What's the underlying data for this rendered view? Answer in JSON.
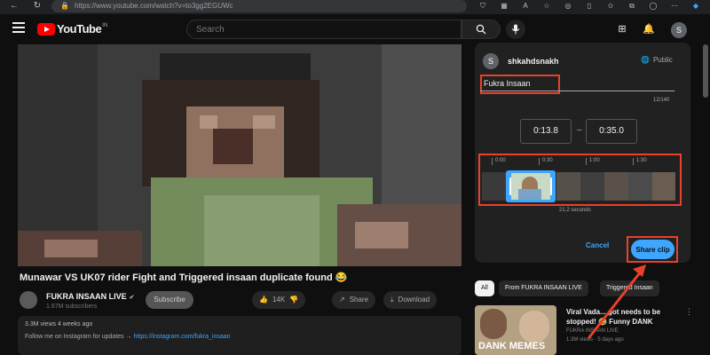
{
  "browser": {
    "url": "https://www.youtube.com/watch?v=to3gg2EGUWc"
  },
  "header": {
    "logo_text": "YouTube",
    "logo_region": "IN",
    "search_placeholder": "Search",
    "avatar_letter": "S"
  },
  "video": {
    "title": "Munawar VS UK07 rider Fight and Triggered insaan duplicate found 😂",
    "channel_name": "FUKRA INSAAN LIVE",
    "subscribers": "1.67M subscribers",
    "subscribe_label": "Subscribe",
    "likes": "14K",
    "share_label": "Share",
    "download_label": "Download",
    "views_age": "3.3M views  4 weeks ago",
    "description": "Follow me on Instagram for updates →",
    "description_link": "https://instagram.com/fukra_insaan"
  },
  "clip_panel": {
    "avatar_letter": "S",
    "username": "shkahdsnakh",
    "visibility": "Public",
    "title_value": "Fukra Insaan",
    "char_count": "12/140",
    "start_time": "0:13.8",
    "end_time": "0:35.0",
    "ticks": [
      "0:00",
      "0:30",
      "1:00",
      "1:30"
    ],
    "duration_text": "21.2 seconds",
    "cancel_label": "Cancel",
    "share_label": "Share clip"
  },
  "sidebar": {
    "chips": [
      "All",
      "From FUKRA INSAAN LIVE",
      "Triggered Insaan"
    ],
    "recommendation": {
      "title": "Viral Vada... got needs to be stopped! 😂 Funny DANK",
      "channel": "FUKRA INSAAN LIVE",
      "meta": "1.3M views · 5 days ago",
      "thumb_text": "DANK MEMES"
    }
  },
  "colors": {
    "background": "#0f0f0f",
    "accent_blue": "#3ea6ff",
    "annotation_red": "#e8412c",
    "youtube_red": "#ff0000"
  }
}
